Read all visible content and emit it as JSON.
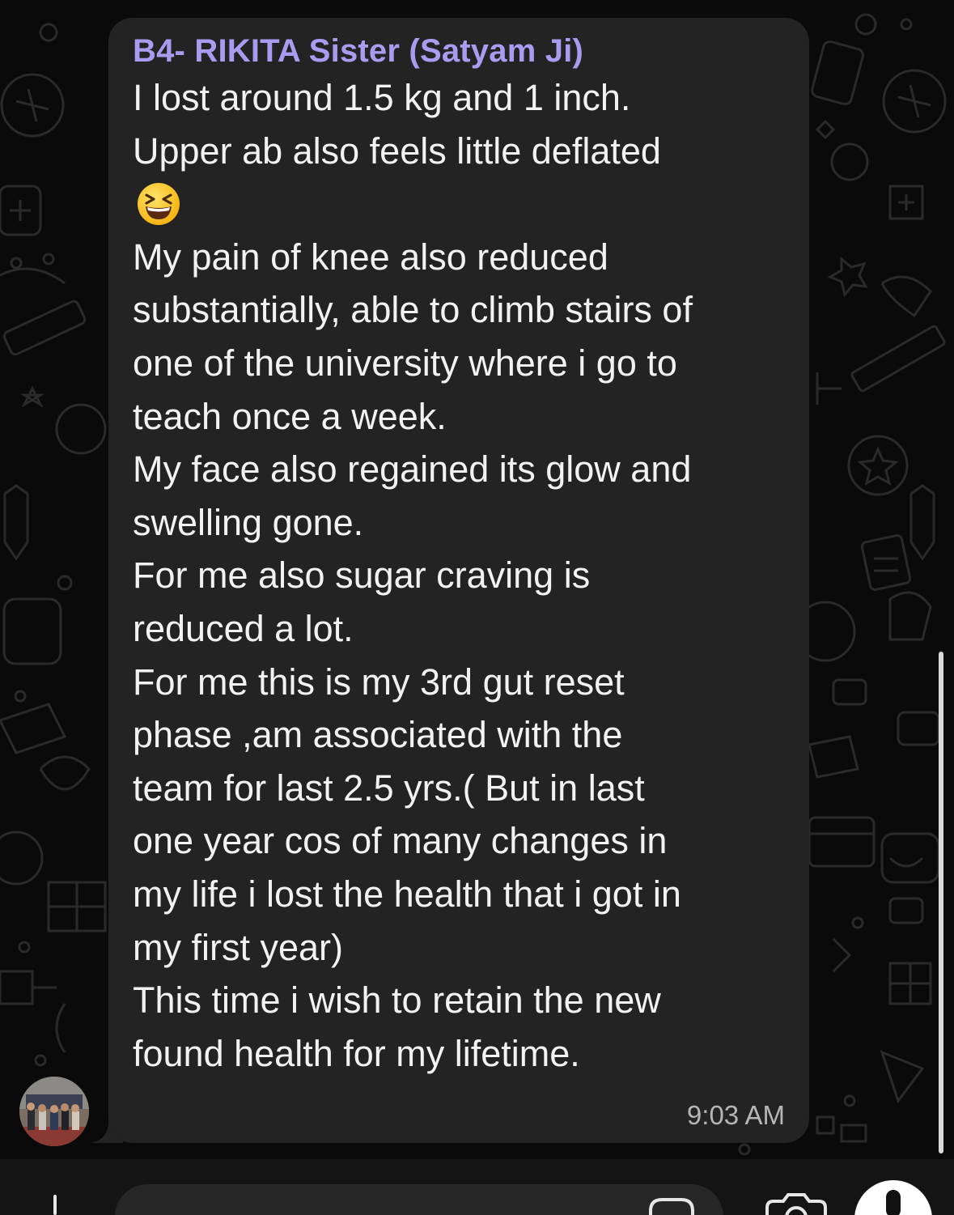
{
  "chat": {
    "message": {
      "sender": "B4- RIKITA Sister (Satyam Ji)",
      "lines_before_emoji": [
        "I lost around 1.5 kg and 1 inch.",
        "Upper ab also feels little deflated"
      ],
      "emoji": "grinning-squinting-face",
      "lines_after_emoji": [
        "My pain of knee also reduced",
        "substantially, able to climb stairs of",
        "one of the university where i go to",
        "teach once a week.",
        "My face also regained its glow and",
        "swelling gone.",
        "For me also sugar craving is",
        "reduced a lot.",
        "For me this is my 3rd gut reset",
        "phase ,am associated with the",
        "team for last 2.5 yrs.( But in last",
        "one year cos of many changes in",
        "my life i lost the health that i got in",
        "my first year)",
        "This time i wish to retain the new",
        "found health for my lifetime."
      ],
      "time": "9:03 AM"
    }
  },
  "composer": {
    "icons": [
      "plus-icon",
      "sticker-icon",
      "camera-icon",
      "microphone-icon"
    ]
  },
  "colors": {
    "background": "#0a0a0a",
    "bubble": "#232323",
    "sender_name": "#a99cf0",
    "message_text": "#f2f2f2",
    "timestamp": "#b5b5b5"
  }
}
